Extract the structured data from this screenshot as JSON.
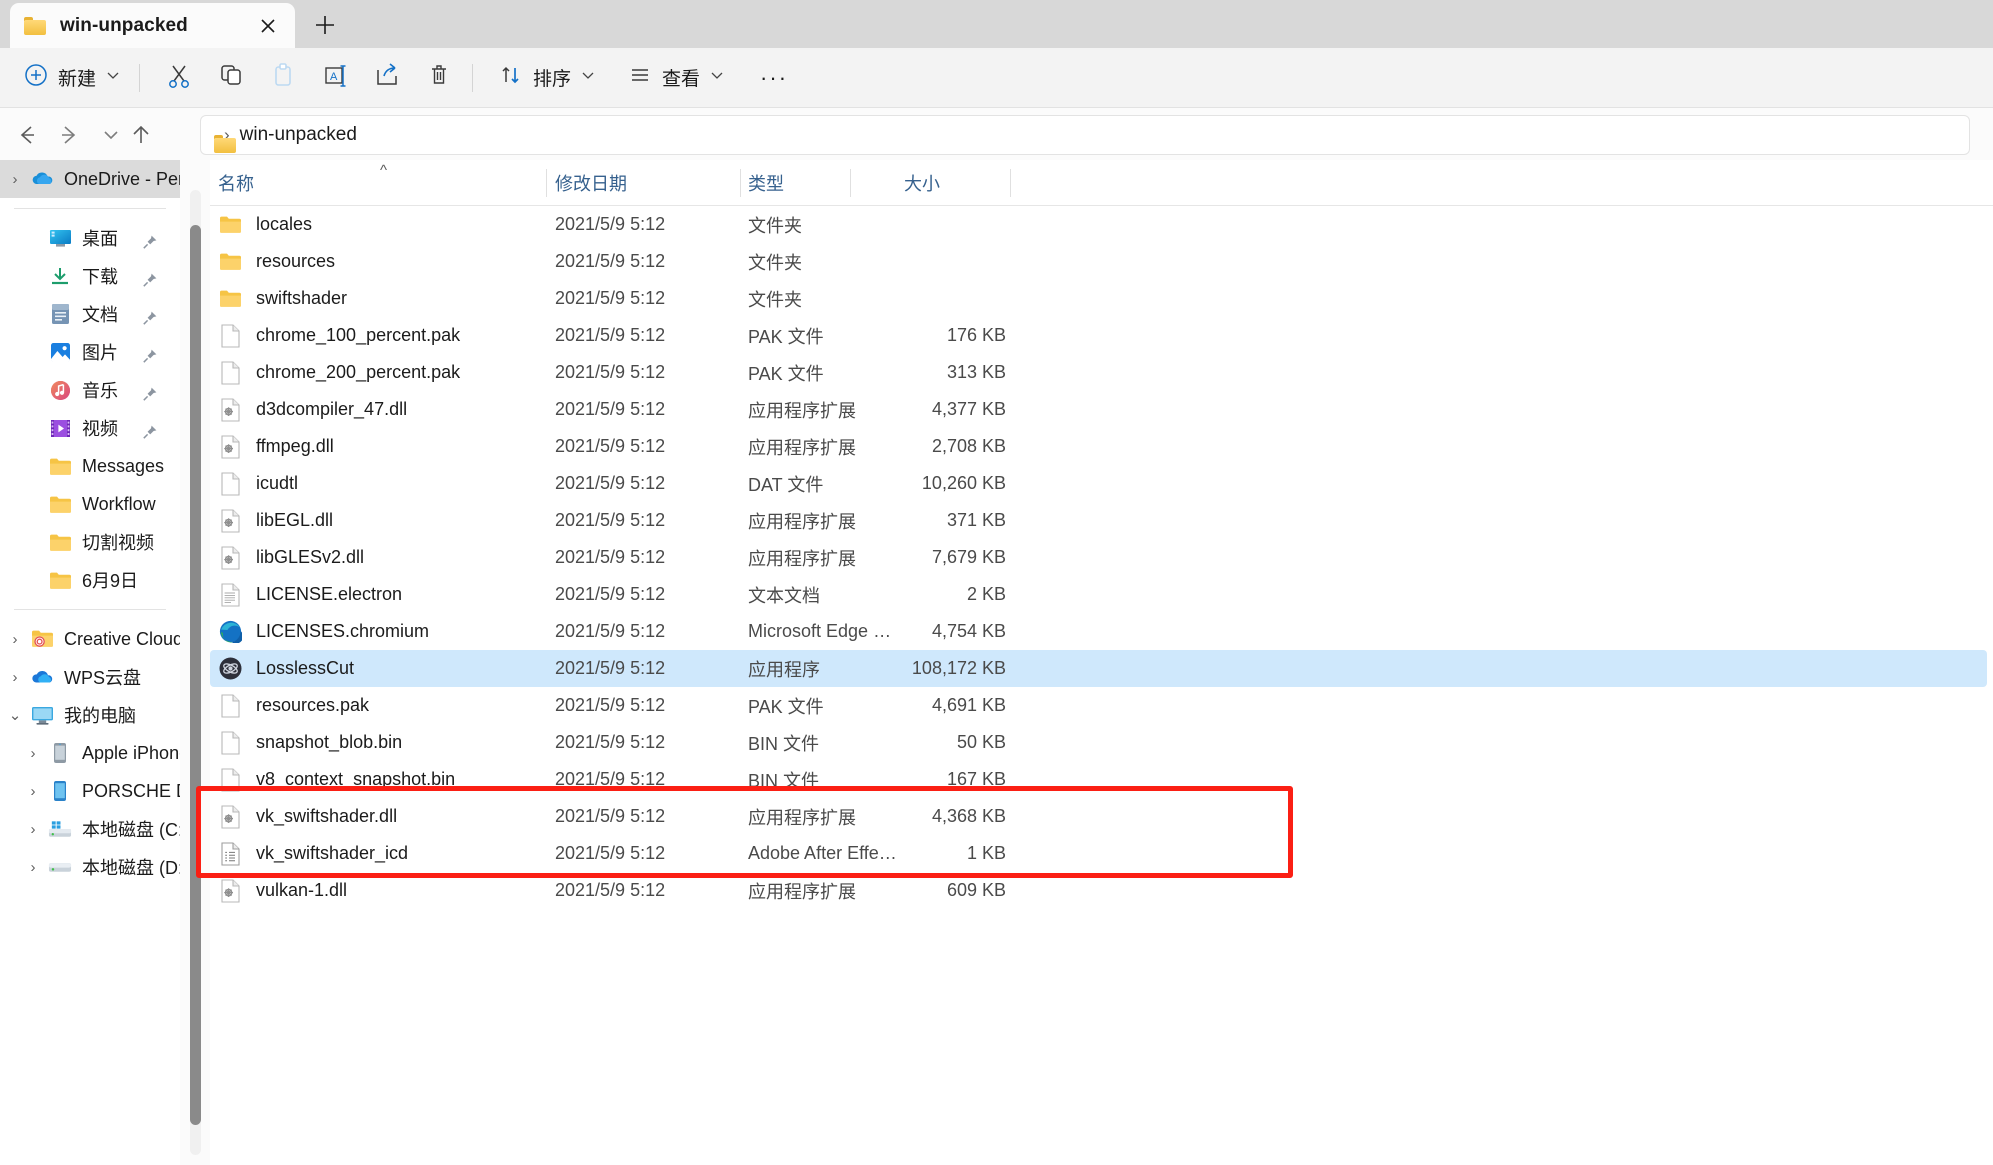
{
  "window": {
    "tab": {
      "title": "win-unpacked",
      "icon": "folder-icon",
      "close_icon": "close-icon"
    },
    "new_tab_label": "+"
  },
  "toolbar": {
    "new_label": "新建",
    "new_icon": "plus-circle-icon",
    "cut_icon": "scissors-icon",
    "copy_icon": "copy-icon",
    "paste_icon": "paste-icon",
    "rename_icon": "rename-icon",
    "share_icon": "share-icon",
    "delete_icon": "trash-icon",
    "sort_label": "排序",
    "sort_icon": "sort-arrows-icon",
    "view_label": "查看",
    "view_icon": "list-lines-icon",
    "more_label": "···"
  },
  "address": {
    "back_icon": "arrow-left-icon",
    "forward_icon": "arrow-right-icon",
    "recent_icon": "chevron-down-icon",
    "up_icon": "arrow-up-icon",
    "crumb_icon": "folder-icon",
    "separator": "›",
    "crumb": "win-unpacked"
  },
  "sidebar": {
    "groups": [
      {
        "items": [
          {
            "label": "OneDrive - Per",
            "icon": "onedrive-icon",
            "expander": "›",
            "selected": true,
            "pinned": false,
            "indent": 1
          }
        ]
      },
      {
        "items": [
          {
            "label": "桌面",
            "icon": "desktop-icon",
            "expander": "",
            "selected": false,
            "pinned": true,
            "indent": 2
          },
          {
            "label": "下载",
            "icon": "downloads-icon",
            "expander": "",
            "selected": false,
            "pinned": true,
            "indent": 2
          },
          {
            "label": "文档",
            "icon": "documents-icon",
            "expander": "",
            "selected": false,
            "pinned": true,
            "indent": 2
          },
          {
            "label": "图片",
            "icon": "pictures-icon",
            "expander": "",
            "selected": false,
            "pinned": true,
            "indent": 2
          },
          {
            "label": "音乐",
            "icon": "music-icon",
            "expander": "",
            "selected": false,
            "pinned": true,
            "indent": 2
          },
          {
            "label": "视频",
            "icon": "videos-icon",
            "expander": "",
            "selected": false,
            "pinned": true,
            "indent": 2
          },
          {
            "label": "Messages",
            "icon": "folder-icon",
            "expander": "",
            "selected": false,
            "pinned": false,
            "indent": 2
          },
          {
            "label": "Workflow",
            "icon": "folder-icon",
            "expander": "",
            "selected": false,
            "pinned": false,
            "indent": 2
          },
          {
            "label": "切割视频",
            "icon": "folder-icon",
            "expander": "",
            "selected": false,
            "pinned": false,
            "indent": 2
          },
          {
            "label": "6月9日",
            "icon": "folder-icon",
            "expander": "",
            "selected": false,
            "pinned": false,
            "indent": 2
          }
        ]
      },
      {
        "items": [
          {
            "label": "Creative Cloud",
            "icon": "creative-cloud-folder-icon",
            "expander": "›",
            "selected": false,
            "pinned": false,
            "indent": 1
          },
          {
            "label": "WPS云盘",
            "icon": "wps-cloud-icon",
            "expander": "›",
            "selected": false,
            "pinned": false,
            "indent": 1
          },
          {
            "label": "我的电脑",
            "icon": "this-pc-icon",
            "expander": "⌄",
            "selected": false,
            "pinned": false,
            "indent": 1
          },
          {
            "label": "Apple iPhone",
            "icon": "iphone-icon",
            "expander": "›",
            "selected": false,
            "pinned": false,
            "indent": 2
          },
          {
            "label": "PORSCHE DES",
            "icon": "portable-device-icon",
            "expander": "›",
            "selected": false,
            "pinned": false,
            "indent": 2
          },
          {
            "label": "本地磁盘 (C:)",
            "icon": "windows-drive-icon",
            "expander": "›",
            "selected": false,
            "pinned": false,
            "indent": 2
          },
          {
            "label": "本地磁盘 (D:)",
            "icon": "drive-icon",
            "expander": "›",
            "selected": false,
            "pinned": false,
            "indent": 2
          }
        ]
      }
    ]
  },
  "filelist": {
    "columns": [
      {
        "label": "名称",
        "key": "name"
      },
      {
        "label": "修改日期",
        "key": "date"
      },
      {
        "label": "类型",
        "key": "type"
      },
      {
        "label": "大小",
        "key": "size"
      }
    ],
    "sort_indicator": "^",
    "rows": [
      {
        "name": "locales",
        "date": "2021/5/9 5:12",
        "type": "文件夹",
        "size": "",
        "icon": "folder-icon",
        "selected": false
      },
      {
        "name": "resources",
        "date": "2021/5/9 5:12",
        "type": "文件夹",
        "size": "",
        "icon": "folder-icon",
        "selected": false
      },
      {
        "name": "swiftshader",
        "date": "2021/5/9 5:12",
        "type": "文件夹",
        "size": "",
        "icon": "folder-icon",
        "selected": false
      },
      {
        "name": "chrome_100_percent.pak",
        "date": "2021/5/9 5:12",
        "type": "PAK 文件",
        "size": "176 KB",
        "icon": "file-icon",
        "selected": false
      },
      {
        "name": "chrome_200_percent.pak",
        "date": "2021/5/9 5:12",
        "type": "PAK 文件",
        "size": "313 KB",
        "icon": "file-icon",
        "selected": false
      },
      {
        "name": "d3dcompiler_47.dll",
        "date": "2021/5/9 5:12",
        "type": "应用程序扩展",
        "size": "4,377 KB",
        "icon": "dll-icon",
        "selected": false
      },
      {
        "name": "ffmpeg.dll",
        "date": "2021/5/9 5:12",
        "type": "应用程序扩展",
        "size": "2,708 KB",
        "icon": "dll-icon",
        "selected": false
      },
      {
        "name": "icudtl",
        "date": "2021/5/9 5:12",
        "type": "DAT 文件",
        "size": "10,260 KB",
        "icon": "file-icon",
        "selected": false
      },
      {
        "name": "libEGL.dll",
        "date": "2021/5/9 5:12",
        "type": "应用程序扩展",
        "size": "371 KB",
        "icon": "dll-icon",
        "selected": false
      },
      {
        "name": "libGLESv2.dll",
        "date": "2021/5/9 5:12",
        "type": "应用程序扩展",
        "size": "7,679 KB",
        "icon": "dll-icon",
        "selected": false
      },
      {
        "name": "LICENSE.electron",
        "date": "2021/5/9 5:12",
        "type": "文本文档",
        "size": "2 KB",
        "icon": "text-icon",
        "selected": false
      },
      {
        "name": "LICENSES.chromium",
        "date": "2021/5/9 5:12",
        "type": "Microsoft Edge HT...",
        "size": "4,754 KB",
        "icon": "edge-icon",
        "selected": false
      },
      {
        "name": "LosslessCut",
        "date": "2021/5/9 5:12",
        "type": "应用程序",
        "size": "108,172 KB",
        "icon": "losslesscut-app-icon",
        "selected": true
      },
      {
        "name": "resources.pak",
        "date": "2021/5/9 5:12",
        "type": "PAK 文件",
        "size": "4,691 KB",
        "icon": "file-icon",
        "selected": false
      },
      {
        "name": "snapshot_blob.bin",
        "date": "2021/5/9 5:12",
        "type": "BIN 文件",
        "size": "50 KB",
        "icon": "file-icon",
        "selected": false
      },
      {
        "name": "v8_context_snapshot.bin",
        "date": "2021/5/9 5:12",
        "type": "BIN 文件",
        "size": "167 KB",
        "icon": "file-icon",
        "selected": false
      },
      {
        "name": "vk_swiftshader.dll",
        "date": "2021/5/9 5:12",
        "type": "应用程序扩展",
        "size": "4,368 KB",
        "icon": "dll-icon",
        "selected": false
      },
      {
        "name": "vk_swiftshader_icd",
        "date": "2021/5/9 5:12",
        "type": "Adobe After Effects...",
        "size": "1 KB",
        "icon": "config-icon",
        "selected": false
      },
      {
        "name": "vulkan-1.dll",
        "date": "2021/5/9 5:12",
        "type": "应用程序扩展",
        "size": "609 KB",
        "icon": "dll-icon",
        "selected": false
      }
    ]
  },
  "annotation": {
    "color": "#fb1f14",
    "target_row": "LosslessCut"
  }
}
